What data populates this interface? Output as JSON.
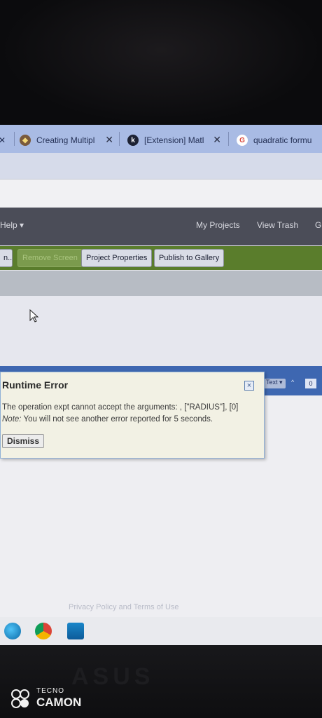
{
  "browser": {
    "tabs": [
      {
        "label": "Creating Multipl",
        "icon": "app-inventor-icon"
      },
      {
        "label": "[Extension] Matl",
        "icon": "k-community-icon"
      },
      {
        "label": "quadratic formu",
        "icon": "google-icon"
      }
    ],
    "close_glyph": "✕"
  },
  "app_header": {
    "help": "Help ▾",
    "my_projects": "My Projects",
    "view_trash": "View Trash",
    "cut_item": "G"
  },
  "designer_toolbar": {
    "cut_button": "n...",
    "remove_screen": "Remove Screen",
    "project_properties": "Project Properties",
    "publish_to_gallery": "Publish to Gallery"
  },
  "blocks_toolbar": {
    "text_dropdown": "Text ▾",
    "up_arrow": "^",
    "counter": "0"
  },
  "dialog": {
    "title": "Runtime Error",
    "close_glyph": "×",
    "message": "The operation expt cannot accept the arguments: , [\"RADIUS\"], [0]",
    "note_label": "Note:",
    "note_text": " You will not see another error reported for 5 seconds.",
    "dismiss": "Dismiss"
  },
  "footer": {
    "links": "Privacy Policy and Terms of Use"
  },
  "taskbar": {
    "icons": [
      "edge-icon",
      "chrome-icon",
      "mail-icon"
    ]
  },
  "device": {
    "brand": "ASUS"
  },
  "watermark": {
    "line1": "TECNO",
    "line2": "CAMON"
  },
  "colors": {
    "tab_strip": "#a9bbe4",
    "app_header": "#4b4d58",
    "green_toolbar": "#5a7d2c",
    "blocks_bar": "#3e67b1",
    "dialog_bg": "#f2f1e4"
  }
}
